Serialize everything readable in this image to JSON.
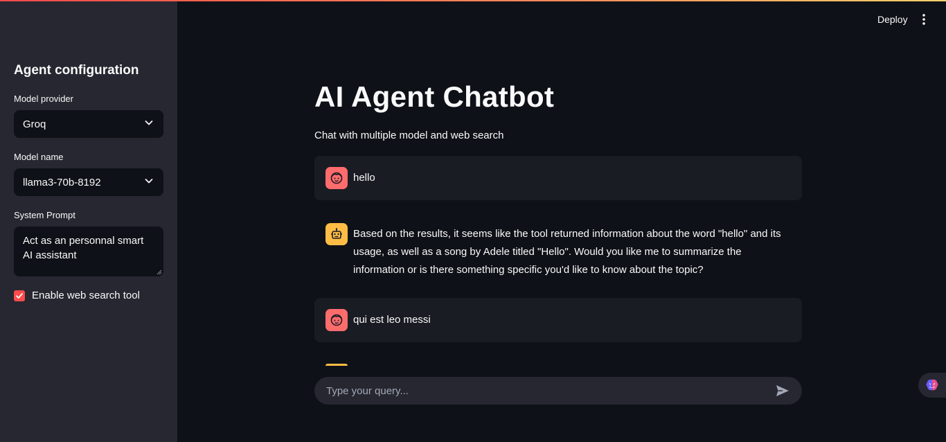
{
  "header": {
    "deploy_label": "Deploy"
  },
  "sidebar": {
    "title": "Agent configuration",
    "model_provider": {
      "label": "Model provider",
      "value": "Groq"
    },
    "model_name": {
      "label": "Model name",
      "value": "llama3-70b-8192"
    },
    "system_prompt": {
      "label": "System Prompt",
      "value": "Act as an personnal smart AI assistant"
    },
    "web_search": {
      "label": "Enable web search tool",
      "checked": true
    }
  },
  "main": {
    "title": "AI Agent Chatbot",
    "subtitle": "Chat with multiple model and web search",
    "messages": [
      {
        "role": "user",
        "text": "hello"
      },
      {
        "role": "assistant",
        "text": "Based on the results, it seems like the tool returned information about the word \"hello\" and its usage, as well as a song by Adele titled \"Hello\". Would you like me to summarize the information or is there something specific you'd like to know about the topic?"
      },
      {
        "role": "user",
        "text": "qui est leo messi"
      }
    ],
    "chat_input": {
      "placeholder": "Type your query...",
      "value": ""
    }
  },
  "icons": {
    "user_avatar": "face-icon",
    "bot_avatar": "robot-icon",
    "dropdown": "chevron-down-icon",
    "menu": "kebab-menu-icon",
    "send": "send-icon",
    "floating": "brain-icon"
  },
  "colors": {
    "accent": "#ff4b4b",
    "user_avatar": "#ff6c6c",
    "bot_avatar": "#ffbd45",
    "sidebar_bg": "#262730",
    "main_bg": "#0e1117"
  }
}
